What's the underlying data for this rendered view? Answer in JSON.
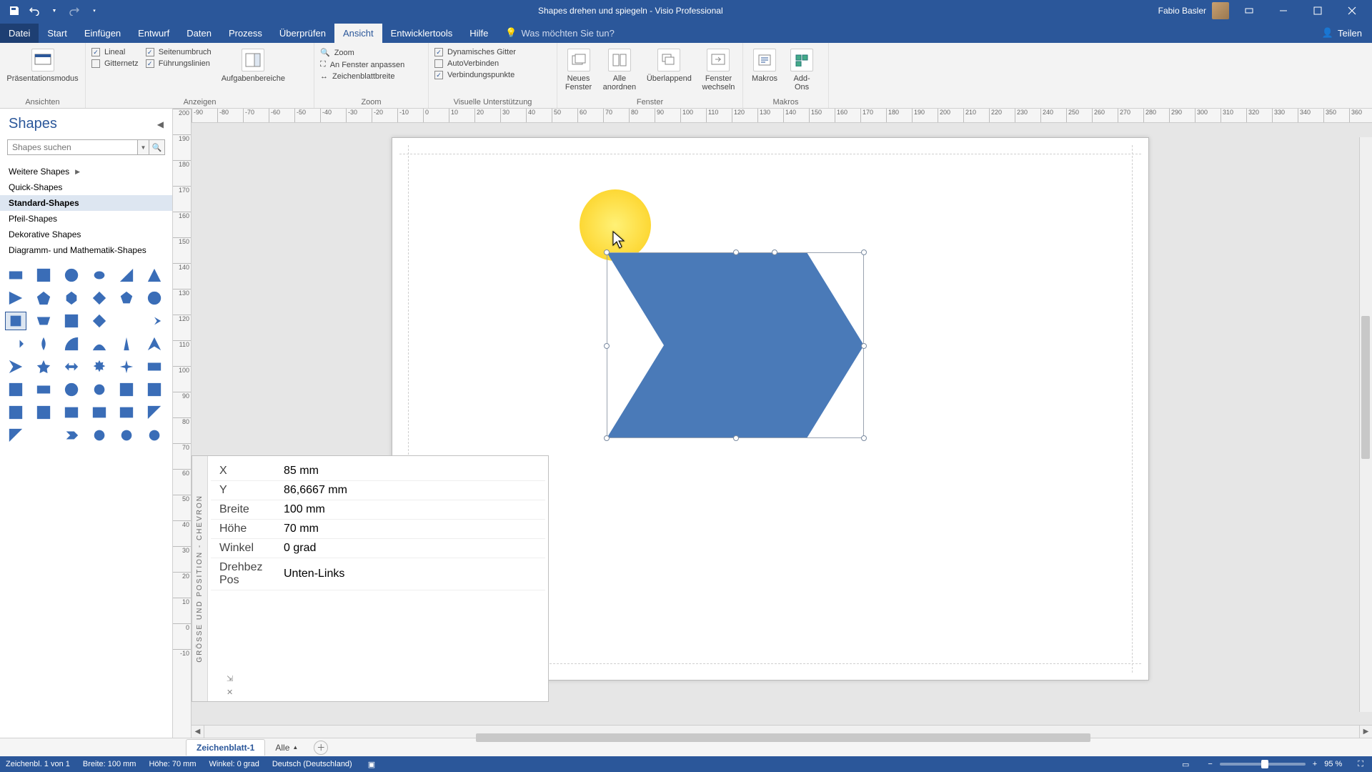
{
  "title": "Shapes drehen und spiegeln  -  Visio Professional",
  "user": "Fabio Basler",
  "qat": {
    "save": "save",
    "undo": "undo",
    "redo": "redo"
  },
  "tabs": {
    "items": [
      "Datei",
      "Start",
      "Einfügen",
      "Entwurf",
      "Daten",
      "Prozess",
      "Überprüfen",
      "Ansicht",
      "Entwicklertools",
      "Hilfe"
    ],
    "active": 7,
    "search": "Was möchten Sie tun?",
    "share": "Teilen"
  },
  "ribbon": {
    "views_group": "Ansichten",
    "presentation": "Präsentationsmodus",
    "show_group": "Anzeigen",
    "lineal": "Lineal",
    "seitenumbruch": "Seitenumbruch",
    "gitternetz": "Gitternetz",
    "fuehrungslinien": "Führungslinien",
    "aufgabenbereiche": "Aufgabenbereiche",
    "zoom_group": "Zoom",
    "zoom": "Zoom",
    "fenster_anpassen": "An Fenster anpassen",
    "blattbreite": "Zeichenblattbreite",
    "visual_group": "Visuelle Unterstützung",
    "dyn_gitter": "Dynamisches Gitter",
    "autoverbinden": "AutoVerbinden",
    "verbindungspunkte": "Verbindungspunkte",
    "window_group": "Fenster",
    "neues_fenster": "Neues\nFenster",
    "alle_anordnen": "Alle\nanordnen",
    "ueberlappend": "Überlappend",
    "fenster_wechseln": "Fenster\nwechseln",
    "macros_group": "Makros",
    "makros": "Makros",
    "addons": "Add-\nOns"
  },
  "shapes_panel": {
    "title": "Shapes",
    "search_placeholder": "Shapes suchen",
    "more": "Weitere Shapes",
    "cats": [
      "Quick-Shapes",
      "Standard-Shapes",
      "Pfeil-Shapes",
      "Dekorative Shapes",
      "Diagramm- und Mathematik-Shapes"
    ],
    "selected": 1
  },
  "size_pos": {
    "panel_title": "GRÖSSE UND POSITION - CHEVRON",
    "rows": [
      {
        "k": "X",
        "v": "85 mm"
      },
      {
        "k": "Y",
        "v": "86,6667 mm"
      },
      {
        "k": "Breite",
        "v": "100 mm"
      },
      {
        "k": "Höhe",
        "v": "70 mm"
      },
      {
        "k": "Winkel",
        "v": "0 grad"
      },
      {
        "k": "Drehbez Pos",
        "v": "Unten-Links"
      }
    ]
  },
  "sheet_tabs": {
    "sheet": "Zeichenblatt-1",
    "all": "Alle"
  },
  "status": {
    "page": "Zeichenbl. 1 von 1",
    "width": "Breite: 100 mm",
    "height": "Höhe: 70 mm",
    "angle": "Winkel: 0 grad",
    "lang": "Deutsch (Deutschland)",
    "zoom": "95 %"
  },
  "ruler": {
    "h_start": -90,
    "h_end": 380,
    "step": 10,
    "v_start": 200,
    "v_end": -10
  }
}
